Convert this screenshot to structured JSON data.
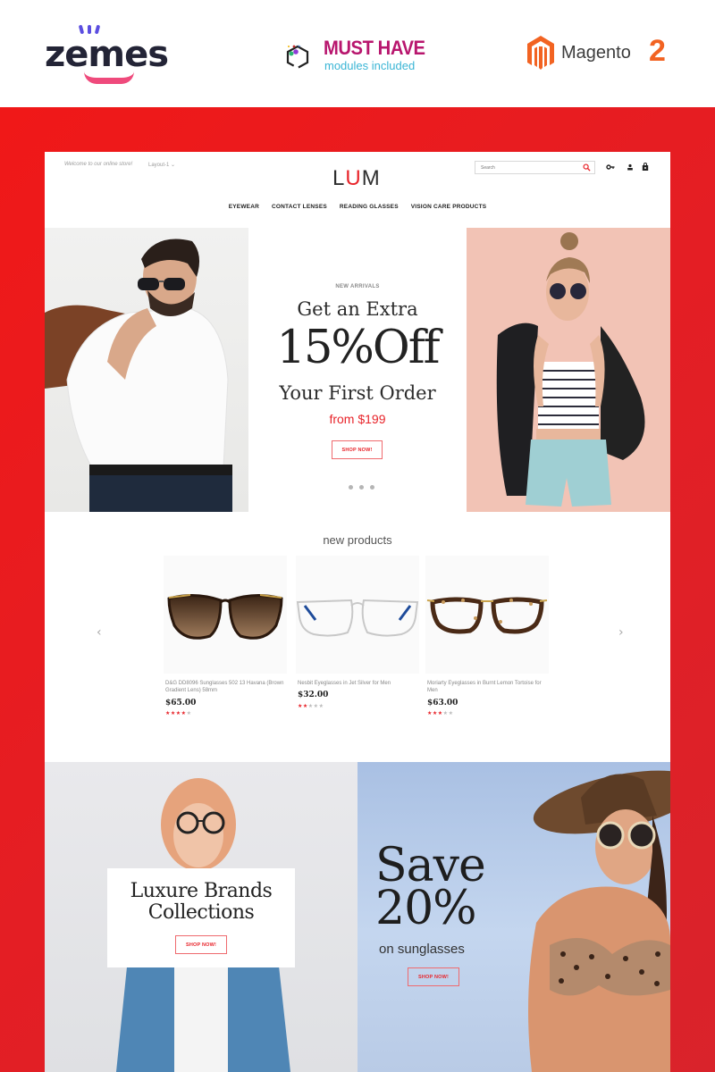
{
  "promo_header": {
    "zemes_logo": "zemes",
    "must_have_title": "MUST HAVE",
    "must_have_subtitle": "modules included",
    "magento_label": "Magento",
    "magento_version": "2",
    "colors": {
      "zemes_dark": "#232436",
      "zemes_purple": "#5b4ee0",
      "zemes_pink": "#ef4a7c",
      "must_have_magenta": "#b8166e",
      "must_have_cyan": "#3ab5d5",
      "magento_orange": "#f26322"
    }
  },
  "frame": {
    "background": "#e41e24"
  },
  "store_header": {
    "welcome": "Welcome to our online store!",
    "layout_switcher": "Layout-1",
    "logo_l": "L",
    "logo_u": "U",
    "logo_m": "M",
    "search_placeholder": "Search",
    "icons": [
      "key-icon",
      "user-icon",
      "shopping-bag-icon"
    ]
  },
  "nav": {
    "items": [
      {
        "label": "EYEWEAR"
      },
      {
        "label": "CONTACT LENSES"
      },
      {
        "label": "READING GLASSES"
      },
      {
        "label": "VISION CARE PRODUCTS"
      }
    ]
  },
  "hero": {
    "eyebrow": "NEW ARRIVALS",
    "line1": "Get an Extra",
    "big": "15%Off",
    "line3": "Your First Order",
    "price": "from $199",
    "button": "SHOP NOW!",
    "slides": 3,
    "active_slide": 1,
    "left_image": "man in white shirt with sunglasses and leather bag",
    "right_image": "woman in striped top with round sunglasses"
  },
  "new_products": {
    "title": "new products",
    "prev_label": "‹",
    "next_label": "›",
    "items": [
      {
        "name": "D&G DD8096 Sunglasses 502 13 Havana (Brown Gradient Lens) 58mm",
        "price": "$65.00",
        "rating": 4,
        "max_rating": 5,
        "image": "tortoise cat-eye sunglasses"
      },
      {
        "name": "Nesbit Eyeglasses in Jet Silver for Men",
        "price": "$32.00",
        "rating": 2,
        "max_rating": 5,
        "image": "silver wire eyeglasses"
      },
      {
        "name": "Moriarty Eyeglasses in Burnt Lemon Tortoise for Men",
        "price": "$63.00",
        "rating": 3,
        "max_rating": 5,
        "image": "tortoise round eyeglasses"
      }
    ]
  },
  "banners": {
    "left": {
      "title_line1": "Luxure Brands",
      "title_line2": "Collections",
      "button": "SHOP NOW!",
      "image": "red-haired woman with glasses in denim jacket"
    },
    "right": {
      "title_line1": "Save",
      "title_line2": "20%",
      "subtitle": "on sunglasses",
      "button": "SHOP NOW!",
      "image": "woman in sun hat and sunglasses"
    }
  },
  "accent_color": "#e8242a"
}
